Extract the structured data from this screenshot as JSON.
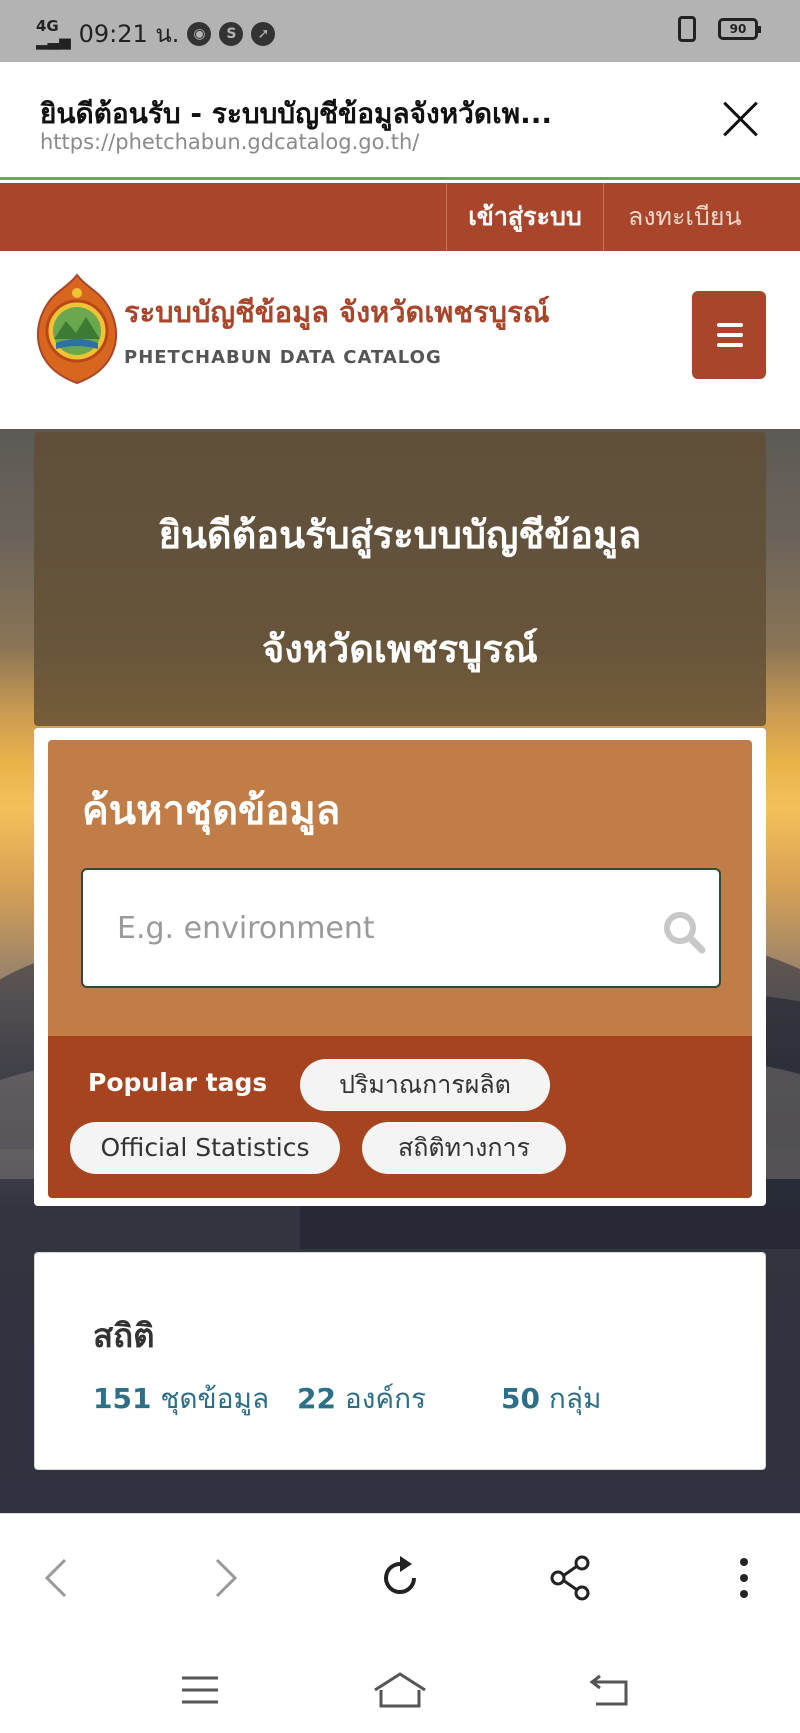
{
  "status_bar": {
    "network": "4G",
    "time": "09:21 น.",
    "battery": "90"
  },
  "tab": {
    "title": "ยินดีต้อนรับ - ระบบบัญชีข้อมูลจังหวัดเพ...",
    "url": "https://phetchabun.gdcatalog.go.th/"
  },
  "auth": {
    "login": "เข้าสู่ระบบ",
    "register": "ลงทะเบียน"
  },
  "site": {
    "title": "ระบบบัญชีข้อมูล จังหวัดเพชรบูรณ์",
    "subtitle": "PHETCHABUN DATA CATALOG"
  },
  "hero": {
    "welcome_line1": "ยินดีต้อนรับสู่ระบบบัญชีข้อมูล",
    "welcome_line2": "จังหวัดเพชรบูรณ์"
  },
  "search": {
    "heading": "ค้นหาชุดข้อมูล",
    "placeholder": "E.g. environment",
    "tags_label": "Popular tags",
    "tags": [
      "ปริมาณการผลิต",
      "Official Statistics",
      "สถิติทางการ"
    ]
  },
  "stats": {
    "title": "สถิติ",
    "items": [
      {
        "count": "151",
        "label": "ชุดข้อมูล"
      },
      {
        "count": "22",
        "label": "องค์กร"
      },
      {
        "count": "50",
        "label": "กลุ่ม"
      }
    ]
  },
  "colors": {
    "brand": "#a8452a",
    "search_panel": "#c07d47",
    "tags_panel": "#a6441f",
    "stat_link": "#2c6f87"
  },
  "icons": {
    "toolbar": [
      "back-icon",
      "forward-icon",
      "reload-icon",
      "share-icon",
      "more-icon"
    ],
    "nav": [
      "menu-icon",
      "home-icon",
      "back-icon"
    ]
  }
}
